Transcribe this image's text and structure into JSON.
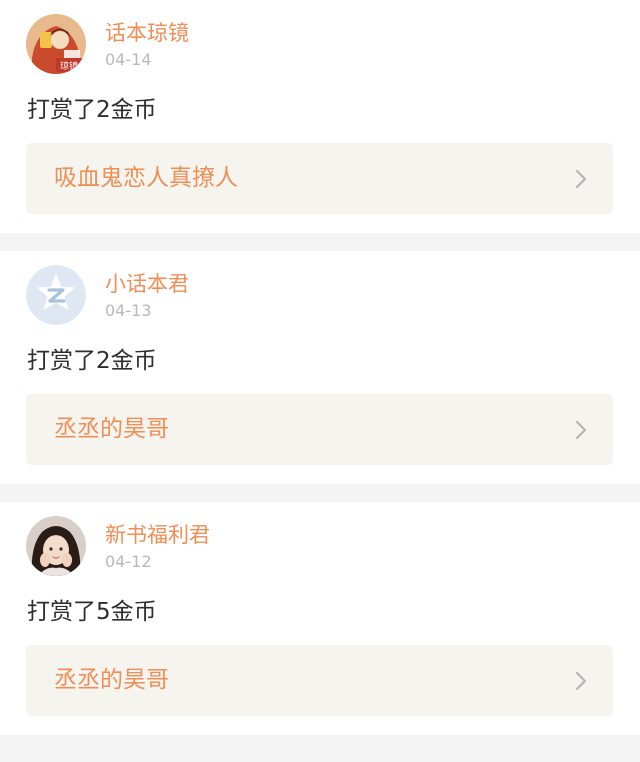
{
  "feed": {
    "items": [
      {
        "username": "话本琼镜",
        "date": "04-14",
        "action": "打赏了2金币",
        "book_title": "吸血鬼恋人真撩人",
        "avatar_badge": "琼镜"
      },
      {
        "username": "小话本君",
        "date": "04-13",
        "action": "打赏了2金币",
        "book_title": "丞丞的昊哥"
      },
      {
        "username": "新书福利君",
        "date": "04-12",
        "action": "打赏了5金币",
        "book_title": "丞丞的昊哥"
      }
    ]
  },
  "colors": {
    "accent": "#ef8e55",
    "date_gray": "#b9b9b9",
    "text_dark": "#2e2e2e",
    "link_bg": "#f5f4ef",
    "divider_bg": "#f4f4f4"
  },
  "icons": {
    "chevron": "chevron-right-icon",
    "default_avatar": "qq-z-logo-icon"
  }
}
